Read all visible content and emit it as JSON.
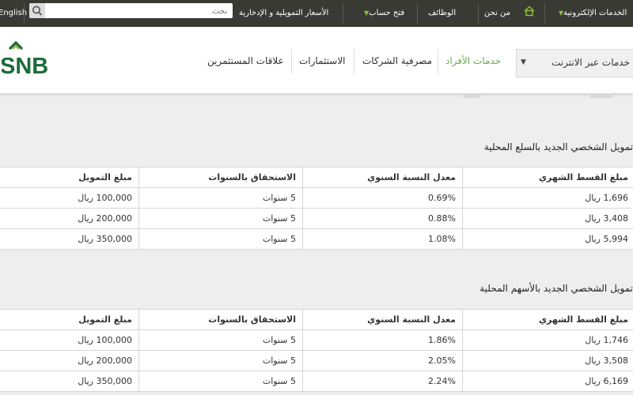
{
  "topbar": {
    "lang": "English",
    "search_placeholder": "بحث",
    "rates_link": "الأسعار التمويلية و الإدخارية",
    "open_account": "فتح حساب",
    "jobs": "الوظائف",
    "about": "من نحن",
    "eservices": "الخدمات الإلكترونية"
  },
  "header": {
    "logo_text": "SNB",
    "online_services": "خدمات عبر الانترنت",
    "nav": {
      "individuals": "خدمات الأفراد",
      "corporate": "مصرفية الشركات",
      "investments": "الاستثمارات",
      "investor_relations": "علاقات المستثمرين"
    },
    "colors": {
      "brand_green": "#1e6b3a",
      "accent_green": "#8fbf3f"
    }
  },
  "tables": [
    {
      "title": "تمويل الشخصي الجديد بالسلع المحلية",
      "headers": [
        "مبلغ التمويل",
        "الاستحقاق بالسنوات",
        "معدل النسبة السنوي",
        "مبلغ القسط الشهري"
      ],
      "rows": [
        [
          "100,000 ريال",
          "5 سنوات",
          "0.69%",
          "1,696 ريال"
        ],
        [
          "200,000 ريال",
          "5 سنوات",
          "0.88%",
          "3,408 ريال"
        ],
        [
          "350,000 ريال",
          "5 سنوات",
          "1.08%",
          "5,994 ريال"
        ]
      ]
    },
    {
      "title": "تمويل الشخصي الجديد بالأسهم المحلية",
      "headers": [
        "مبلغ التمويل",
        "الاستحقاق بالسنوات",
        "معدل النسبة السنوي",
        "مبلغ القسط الشهري"
      ],
      "rows": [
        [
          "100,000 ريال",
          "5 سنوات",
          "1.86%",
          "1,746 ريال"
        ],
        [
          "200,000 ريال",
          "5 سنوات",
          "2.05%",
          "3,508 ريال"
        ],
        [
          "350,000 ريال",
          "5 سنوات",
          "2.24%",
          "6,169 ريال"
        ]
      ]
    }
  ]
}
